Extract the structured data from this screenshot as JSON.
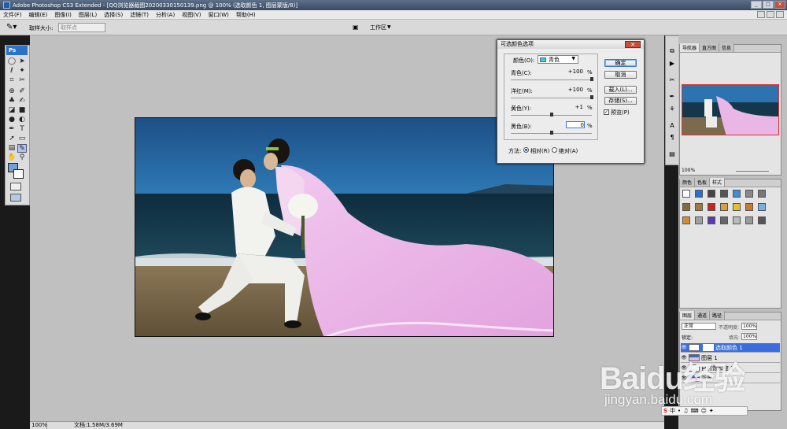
{
  "app": {
    "title": "Adobe Photoshop CS3 Extended - [QQ浏览器截图20200330150139.png @ 100% (选取颜色 1, 图层蒙版/8)]",
    "window_controls": [
      "_",
      "□",
      "✕"
    ]
  },
  "menu": {
    "items": [
      "文件(F)",
      "编辑(E)",
      "图像(I)",
      "图层(L)",
      "选择(S)",
      "滤镜(T)",
      "分析(A)",
      "视图(V)",
      "窗口(W)",
      "帮助(H)"
    ]
  },
  "options_bar": {
    "sample_size_label": "取样大小:",
    "sample_size_value": "取样点",
    "workspace_label": "工作区"
  },
  "dialog": {
    "title": "可选颜色选项",
    "colors_label": "颜色(O):",
    "colors_value": "青色",
    "sliders": [
      {
        "label": "青色(C):",
        "value": "+100",
        "unit": "%",
        "level": 1.0
      },
      {
        "label": "洋红(M):",
        "value": "+100",
        "unit": "%",
        "level": 1.0
      },
      {
        "label": "黄色(Y):",
        "value": "+1",
        "unit": "%",
        "level": 0.505
      },
      {
        "label": "黑色(B):",
        "value": "0",
        "unit": "%",
        "level": 0.5
      }
    ],
    "buttons": {
      "ok": "确定",
      "cancel": "取消",
      "load": "载入(L)...",
      "save": "存储(S)..."
    },
    "preview_label": "预览(P)",
    "preview_checked": true,
    "method_label": "方法:",
    "method_relative": "相对(R)",
    "method_absolute": "绝对(A)",
    "method_selected": "relative"
  },
  "status": {
    "zoom": "100%",
    "doc": "文档:1.58M/3.69M"
  },
  "panels": {
    "navigator_tabs": [
      "导航器",
      "直方图",
      "信息"
    ],
    "navigator_zoom": "100%",
    "swatch_tabs": [
      "颜色",
      "色板",
      "样式"
    ],
    "layers_tabs": [
      "图层",
      "通道",
      "路径"
    ],
    "blend_mode": "正常",
    "opacity_label": "不透明度:",
    "opacity_value": "100%",
    "lock_label": "锁定:",
    "fill_label": "填充:",
    "fill_value": "100%",
    "layers": [
      {
        "name": "选取颜色 1",
        "selected": true
      },
      {
        "name": "图层 1",
        "selected": false
      },
      {
        "name": "自然饱和度 1",
        "selected": false
      },
      {
        "name": "背景",
        "selected": false
      }
    ]
  },
  "watermark": {
    "logo": "Baidu经验",
    "url": "jingyan.baidu.com"
  },
  "ime": {
    "label": "中"
  },
  "colors": {
    "accent": "#3a6ee0",
    "title_bar": "#3a4a64",
    "canvas_bg": "#c0c0c0",
    "fg_color": "#6fa1d6",
    "dialog_swatch_cyan": "#35c8f0"
  }
}
